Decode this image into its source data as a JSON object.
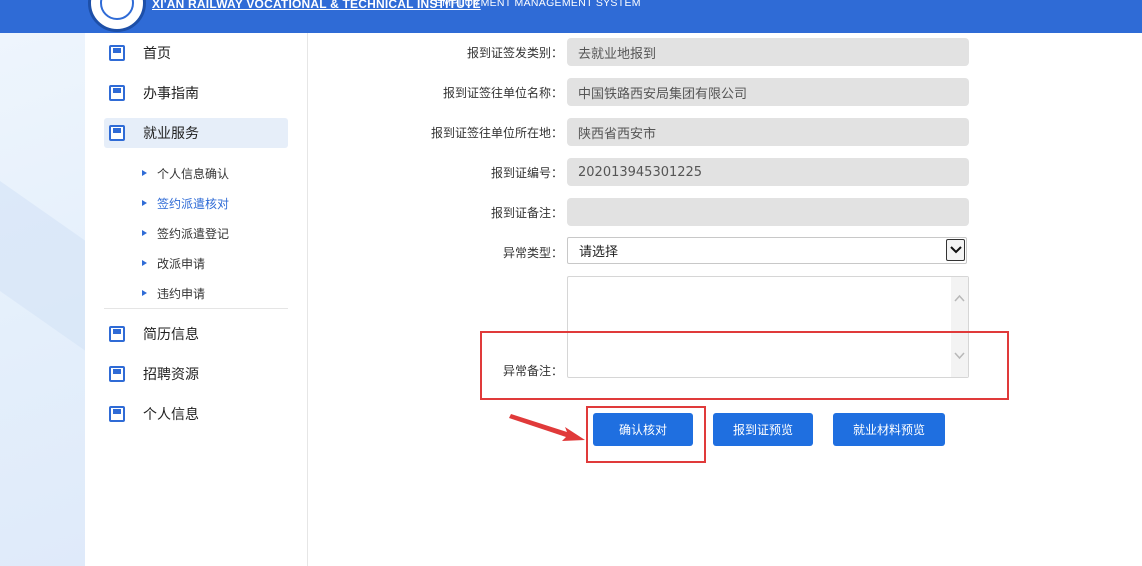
{
  "header": {
    "school_name_en": "XI'AN RAILWAY VOCATIONAL & TECHNICAL INSTITUTE",
    "system_name_en": "EMPLOYMENT MANAGEMENT SYSTEM"
  },
  "sidebar": {
    "items": [
      {
        "label": "首页",
        "icon": "page-icon"
      },
      {
        "label": "办事指南",
        "icon": "page-icon"
      },
      {
        "label": "就业服务",
        "icon": "page-icon",
        "active": true
      },
      {
        "label": "简历信息",
        "icon": "page-icon"
      },
      {
        "label": "招聘资源",
        "icon": "page-icon"
      },
      {
        "label": "个人信息",
        "icon": "page-icon"
      }
    ],
    "sub_items": [
      {
        "label": "个人信息确认"
      },
      {
        "label": "签约派遣核对",
        "active": true
      },
      {
        "label": "签约派遣登记"
      },
      {
        "label": "改派申请"
      },
      {
        "label": "违约申请"
      }
    ]
  },
  "form": {
    "fields": [
      {
        "label": "报到证签发类别：",
        "value": "去就业地报到"
      },
      {
        "label": "报到证签往单位名称：",
        "value": "中国铁路西安局集团有限公司"
      },
      {
        "label": "报到证签往单位所在地：",
        "value": "陕西省西安市"
      },
      {
        "label": "报到证编号：",
        "value": "202013945301225"
      },
      {
        "label": "报到证备注：",
        "value": ""
      }
    ],
    "exception_type": {
      "label": "异常类型：",
      "selected": "请选择"
    },
    "exception_note": {
      "label": "异常备注：",
      "value": ""
    }
  },
  "buttons": {
    "confirm": "确认核对",
    "certificate_preview": "报到证预览",
    "materials_preview": "就业材料预览"
  },
  "colors": {
    "primary": "#1f6fe0",
    "header": "#2f6bd6",
    "annotation": "#e03a3a",
    "field_bg": "#e2e2e2"
  }
}
